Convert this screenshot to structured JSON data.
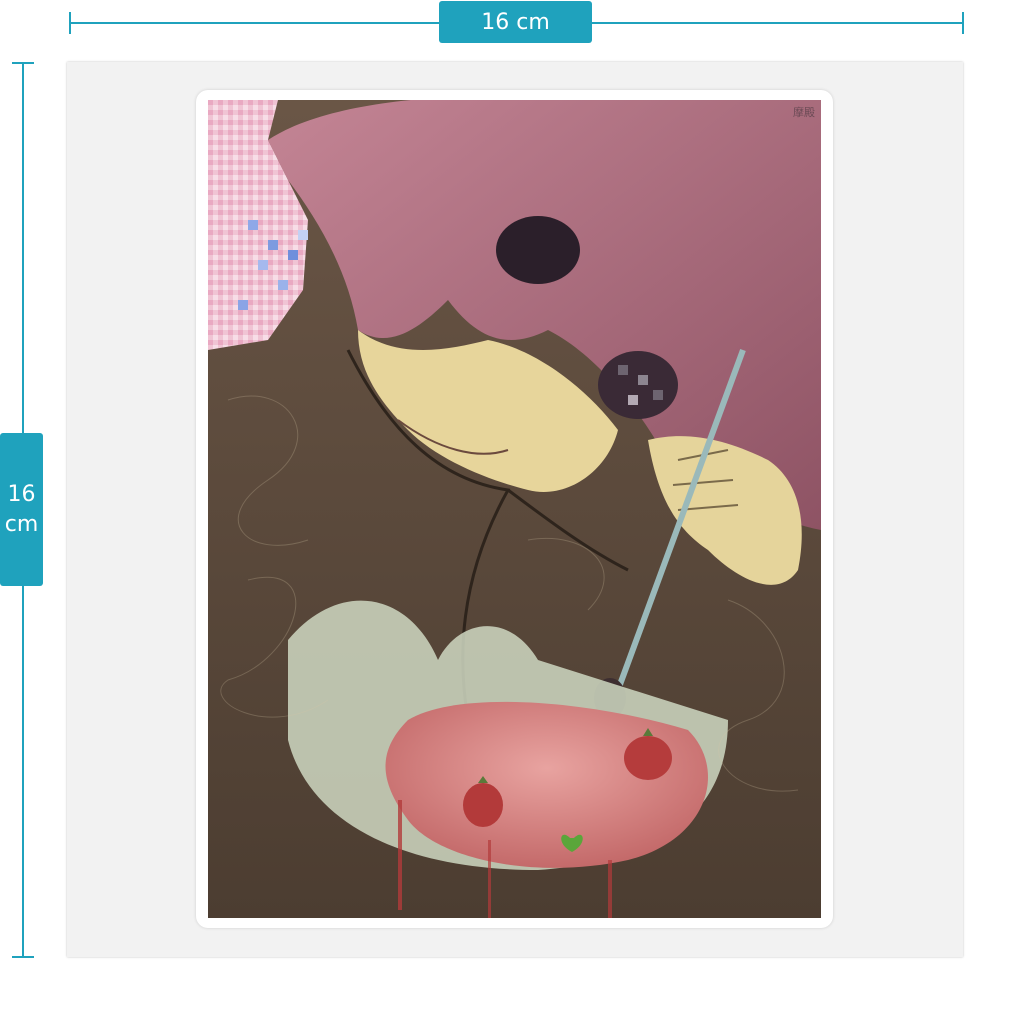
{
  "dimensions": {
    "width_label": "16 cm",
    "height_value": "16",
    "height_unit": "cm"
  },
  "artwork": {
    "signature": "摩殿"
  },
  "colors": {
    "accent": "#1fa2bd",
    "sheet": "#f2f2f2",
    "hair": "#b07080",
    "jacket": "#5e4a3a",
    "skin": "#e8d79a",
    "strawberry": "#b33a3a"
  }
}
